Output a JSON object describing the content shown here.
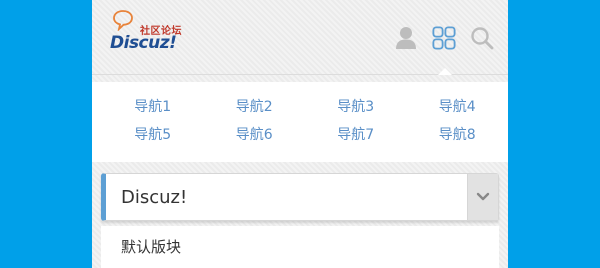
{
  "header": {
    "logo_tagline": "社区论坛",
    "logo_brand": "Discuz!",
    "icons": [
      "user-icon",
      "grid-icon",
      "search-icon"
    ]
  },
  "nav": {
    "items": [
      {
        "label": "导航1"
      },
      {
        "label": "导航2"
      },
      {
        "label": "导航3"
      },
      {
        "label": "导航4"
      },
      {
        "label": "导航5"
      },
      {
        "label": "导航6"
      },
      {
        "label": "导航7"
      },
      {
        "label": "导航8"
      }
    ]
  },
  "forum_select": {
    "value": "Discuz!",
    "options": [
      {
        "label": "默认版块"
      }
    ]
  },
  "colors": {
    "background": "#00a0e9",
    "accent": "#5d9fd4",
    "nav_link": "#5a8fc7",
    "icon_active": "#5d9fd4",
    "icon_inactive": "#bdbdbd"
  }
}
